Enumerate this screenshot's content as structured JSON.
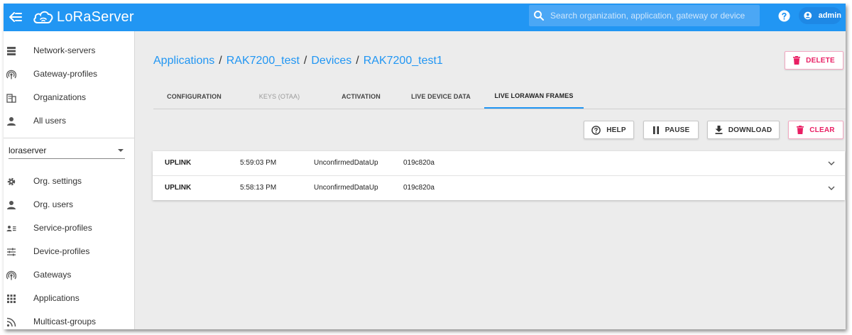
{
  "app": {
    "name": "LoRaServer",
    "search_placeholder": "Search organization, application, gateway or device",
    "user": "admin"
  },
  "sidebar": {
    "global_items": [
      {
        "label": "Network-servers",
        "icon": "server-icon"
      },
      {
        "label": "Gateway-profiles",
        "icon": "broadcast-icon"
      },
      {
        "label": "Organizations",
        "icon": "domain-icon"
      },
      {
        "label": "All users",
        "icon": "user-icon"
      }
    ],
    "organization": "loraserver",
    "org_items": [
      {
        "label": "Org. settings",
        "icon": "gear-icon"
      },
      {
        "label": "Org. users",
        "icon": "user-icon"
      },
      {
        "label": "Service-profiles",
        "icon": "account-details-icon"
      },
      {
        "label": "Device-profiles",
        "icon": "tune-icon"
      },
      {
        "label": "Gateways",
        "icon": "broadcast-icon"
      },
      {
        "label": "Applications",
        "icon": "apps-grid-icon"
      },
      {
        "label": "Multicast-groups",
        "icon": "rss-icon"
      }
    ]
  },
  "breadcrumb": {
    "items": [
      "Applications",
      "RAK7200_test",
      "Devices",
      "RAK7200_test1"
    ],
    "separator": "/"
  },
  "actions": {
    "delete": "DELETE",
    "help": "HELP",
    "pause": "PAUSE",
    "download": "DOWNLOAD",
    "clear": "CLEAR"
  },
  "tabs": [
    {
      "label": "CONFIGURATION",
      "state": "normal"
    },
    {
      "label": "KEYS (OTAA)",
      "state": "disabled"
    },
    {
      "label": "ACTIVATION",
      "state": "normal"
    },
    {
      "label": "LIVE DEVICE DATA",
      "state": "normal"
    },
    {
      "label": "LIVE LORAWAN FRAMES",
      "state": "active"
    }
  ],
  "frames": [
    {
      "direction": "UPLINK",
      "time": "5:59:03 PM",
      "type": "UnconfirmedDataUp",
      "dev_addr": "019c820a"
    },
    {
      "direction": "UPLINK",
      "time": "5:58:13 PM",
      "type": "UnconfirmedDataUp",
      "dev_addr": "019c820a"
    }
  ],
  "colors": {
    "primary": "#2196f3",
    "danger": "#e91e63",
    "background": "#ececec"
  }
}
